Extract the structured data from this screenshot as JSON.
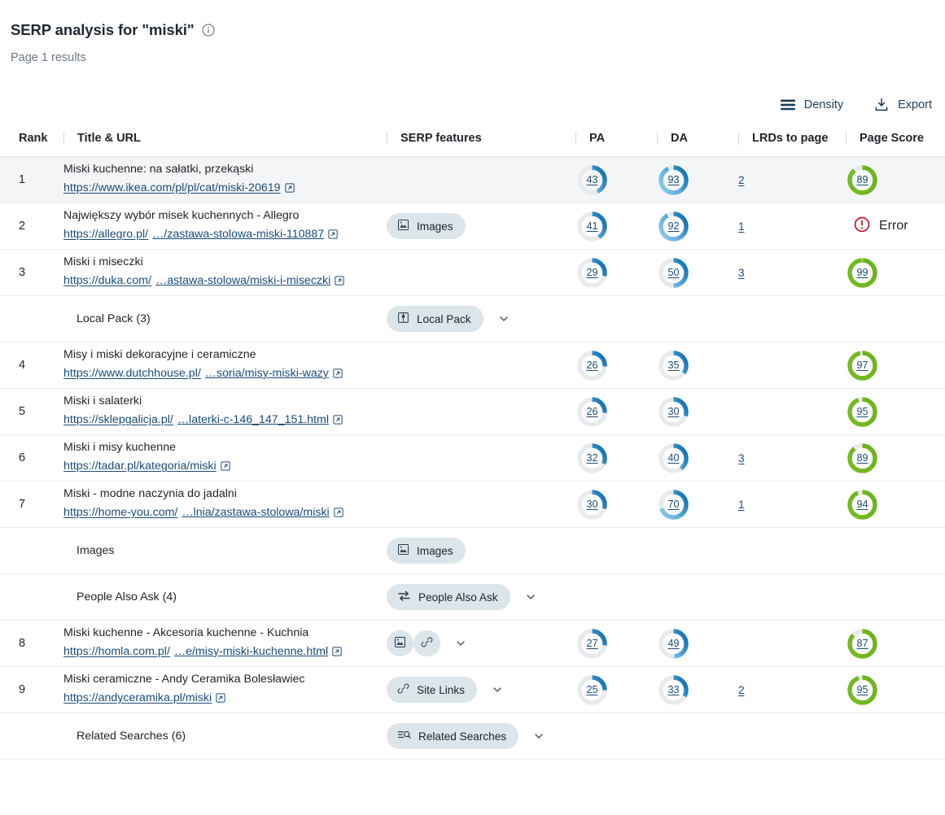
{
  "header": {
    "title": "SERP analysis for \"miski\"",
    "info_icon": "info-icon",
    "subtitle": "Page 1 results"
  },
  "toolbar": {
    "density_label": "Density",
    "density_icon": "density-lines-icon",
    "export_label": "Export",
    "export_icon": "download-icon"
  },
  "columns": {
    "rank": "Rank",
    "title_url": "Title & URL",
    "serp_features": "SERP features",
    "pa": "PA",
    "da": "DA",
    "lrds": "LRDs to page",
    "page_score": "Page Score"
  },
  "colors": {
    "chip_bg": "#dce5ea",
    "link": "#1c4c7c",
    "donut_track": "#e8eaec",
    "donut_blue_light": "#62b0e0",
    "donut_blue_dark": "#1274b5",
    "donut_green": "#76bc21",
    "error_red": "#c8102e",
    "row_highlight": "#f4f5f6"
  },
  "rows": [
    {
      "kind": "result",
      "rank": "1",
      "highlight": true,
      "title": "Miski kuchenne: na sałatki, przekąski",
      "url_domain": "https://www.ikea.com/pl/pl/cat/miski-20619",
      "url_path": "",
      "features": [],
      "caret": false,
      "pa": "43",
      "da": "93",
      "lrds": "2",
      "score": "89",
      "score_error": false
    },
    {
      "kind": "result",
      "rank": "2",
      "highlight": false,
      "title": "Największy wybór misek kuchennych - Allegro",
      "url_domain": "https://allegro.pl/",
      "url_path": "…/zastawa-stolowa-miski-110887",
      "features": [
        {
          "label": "Images",
          "icon": "image-icon"
        }
      ],
      "caret": false,
      "pa": "41",
      "da": "92",
      "lrds": "1",
      "score": "Error",
      "score_error": true
    },
    {
      "kind": "result",
      "rank": "3",
      "highlight": false,
      "title": "Miski i miseczki",
      "url_domain": "https://duka.com/",
      "url_path": "…astawa-stolowa/miski-i-miseczki",
      "features": [],
      "caret": false,
      "pa": "29",
      "da": "50",
      "lrds": "3",
      "score": "99",
      "score_error": false
    },
    {
      "kind": "feature",
      "rank": "",
      "highlight": false,
      "label": "Local Pack (3)",
      "features": [
        {
          "label": "Local Pack",
          "icon": "map-pin-icon"
        }
      ],
      "caret": true
    },
    {
      "kind": "result",
      "rank": "4",
      "highlight": false,
      "title": "Misy i miski dekoracyjne i ceramiczne",
      "url_domain": "https://www.dutchhouse.pl/",
      "url_path": "…soria/misy-miski-wazy",
      "features": [],
      "caret": false,
      "pa": "26",
      "da": "35",
      "lrds": "",
      "score": "97",
      "score_error": false
    },
    {
      "kind": "result",
      "rank": "5",
      "highlight": false,
      "title": "Miski i salaterki",
      "url_domain": "https://sklepgalicja.pl/",
      "url_path": "…laterki-c-146_147_151.html",
      "features": [],
      "caret": false,
      "pa": "26",
      "da": "30",
      "lrds": "",
      "score": "95",
      "score_error": false
    },
    {
      "kind": "result",
      "rank": "6",
      "highlight": false,
      "title": "Miski i misy kuchenne",
      "url_domain": "https://tadar.pl/kategoria/miski",
      "url_path": "",
      "features": [],
      "caret": false,
      "pa": "32",
      "da": "40",
      "lrds": "3",
      "score": "89",
      "score_error": false
    },
    {
      "kind": "result",
      "rank": "7",
      "highlight": false,
      "title": "Miski - modne naczynia do jadalni",
      "url_domain": "https://home-you.com/",
      "url_path": "…lnia/zastawa-stolowa/miski",
      "features": [],
      "caret": false,
      "pa": "30",
      "da": "70",
      "lrds": "1",
      "score": "94",
      "score_error": false
    },
    {
      "kind": "feature",
      "rank": "",
      "highlight": false,
      "label": "Images",
      "features": [
        {
          "label": "Images",
          "icon": "image-icon"
        }
      ],
      "caret": false
    },
    {
      "kind": "feature",
      "rank": "",
      "highlight": false,
      "label": "People Also Ask (4)",
      "features": [
        {
          "label": "People Also Ask",
          "icon": "arrows-icon"
        }
      ],
      "caret": true
    },
    {
      "kind": "result",
      "rank": "8",
      "highlight": false,
      "title": "Miski kuchenne - Akcesoria kuchenne - Kuchnia",
      "url_domain": "https://homla.com.pl/",
      "url_path": "…e/misy-miski-kuchenne.html",
      "features": [
        {
          "label": "",
          "icon": "image-icon"
        },
        {
          "label": "",
          "icon": "link-icon"
        }
      ],
      "caret": true,
      "pa": "27",
      "da": "49",
      "lrds": "",
      "score": "87",
      "score_error": false
    },
    {
      "kind": "result",
      "rank": "9",
      "highlight": false,
      "title": "Miski ceramiczne - Andy Ceramika Bolesławiec",
      "url_domain": "https://andyceramika.pl/miski",
      "url_path": "",
      "features": [
        {
          "label": "Site Links",
          "icon": "link-icon"
        }
      ],
      "caret": true,
      "pa": "25",
      "da": "33",
      "lrds": "2",
      "score": "95",
      "score_error": false
    },
    {
      "kind": "feature",
      "rank": "",
      "highlight": false,
      "label": "Related Searches (6)",
      "features": [
        {
          "label": "Related Searches",
          "icon": "list-search-icon"
        }
      ],
      "caret": true
    }
  ]
}
